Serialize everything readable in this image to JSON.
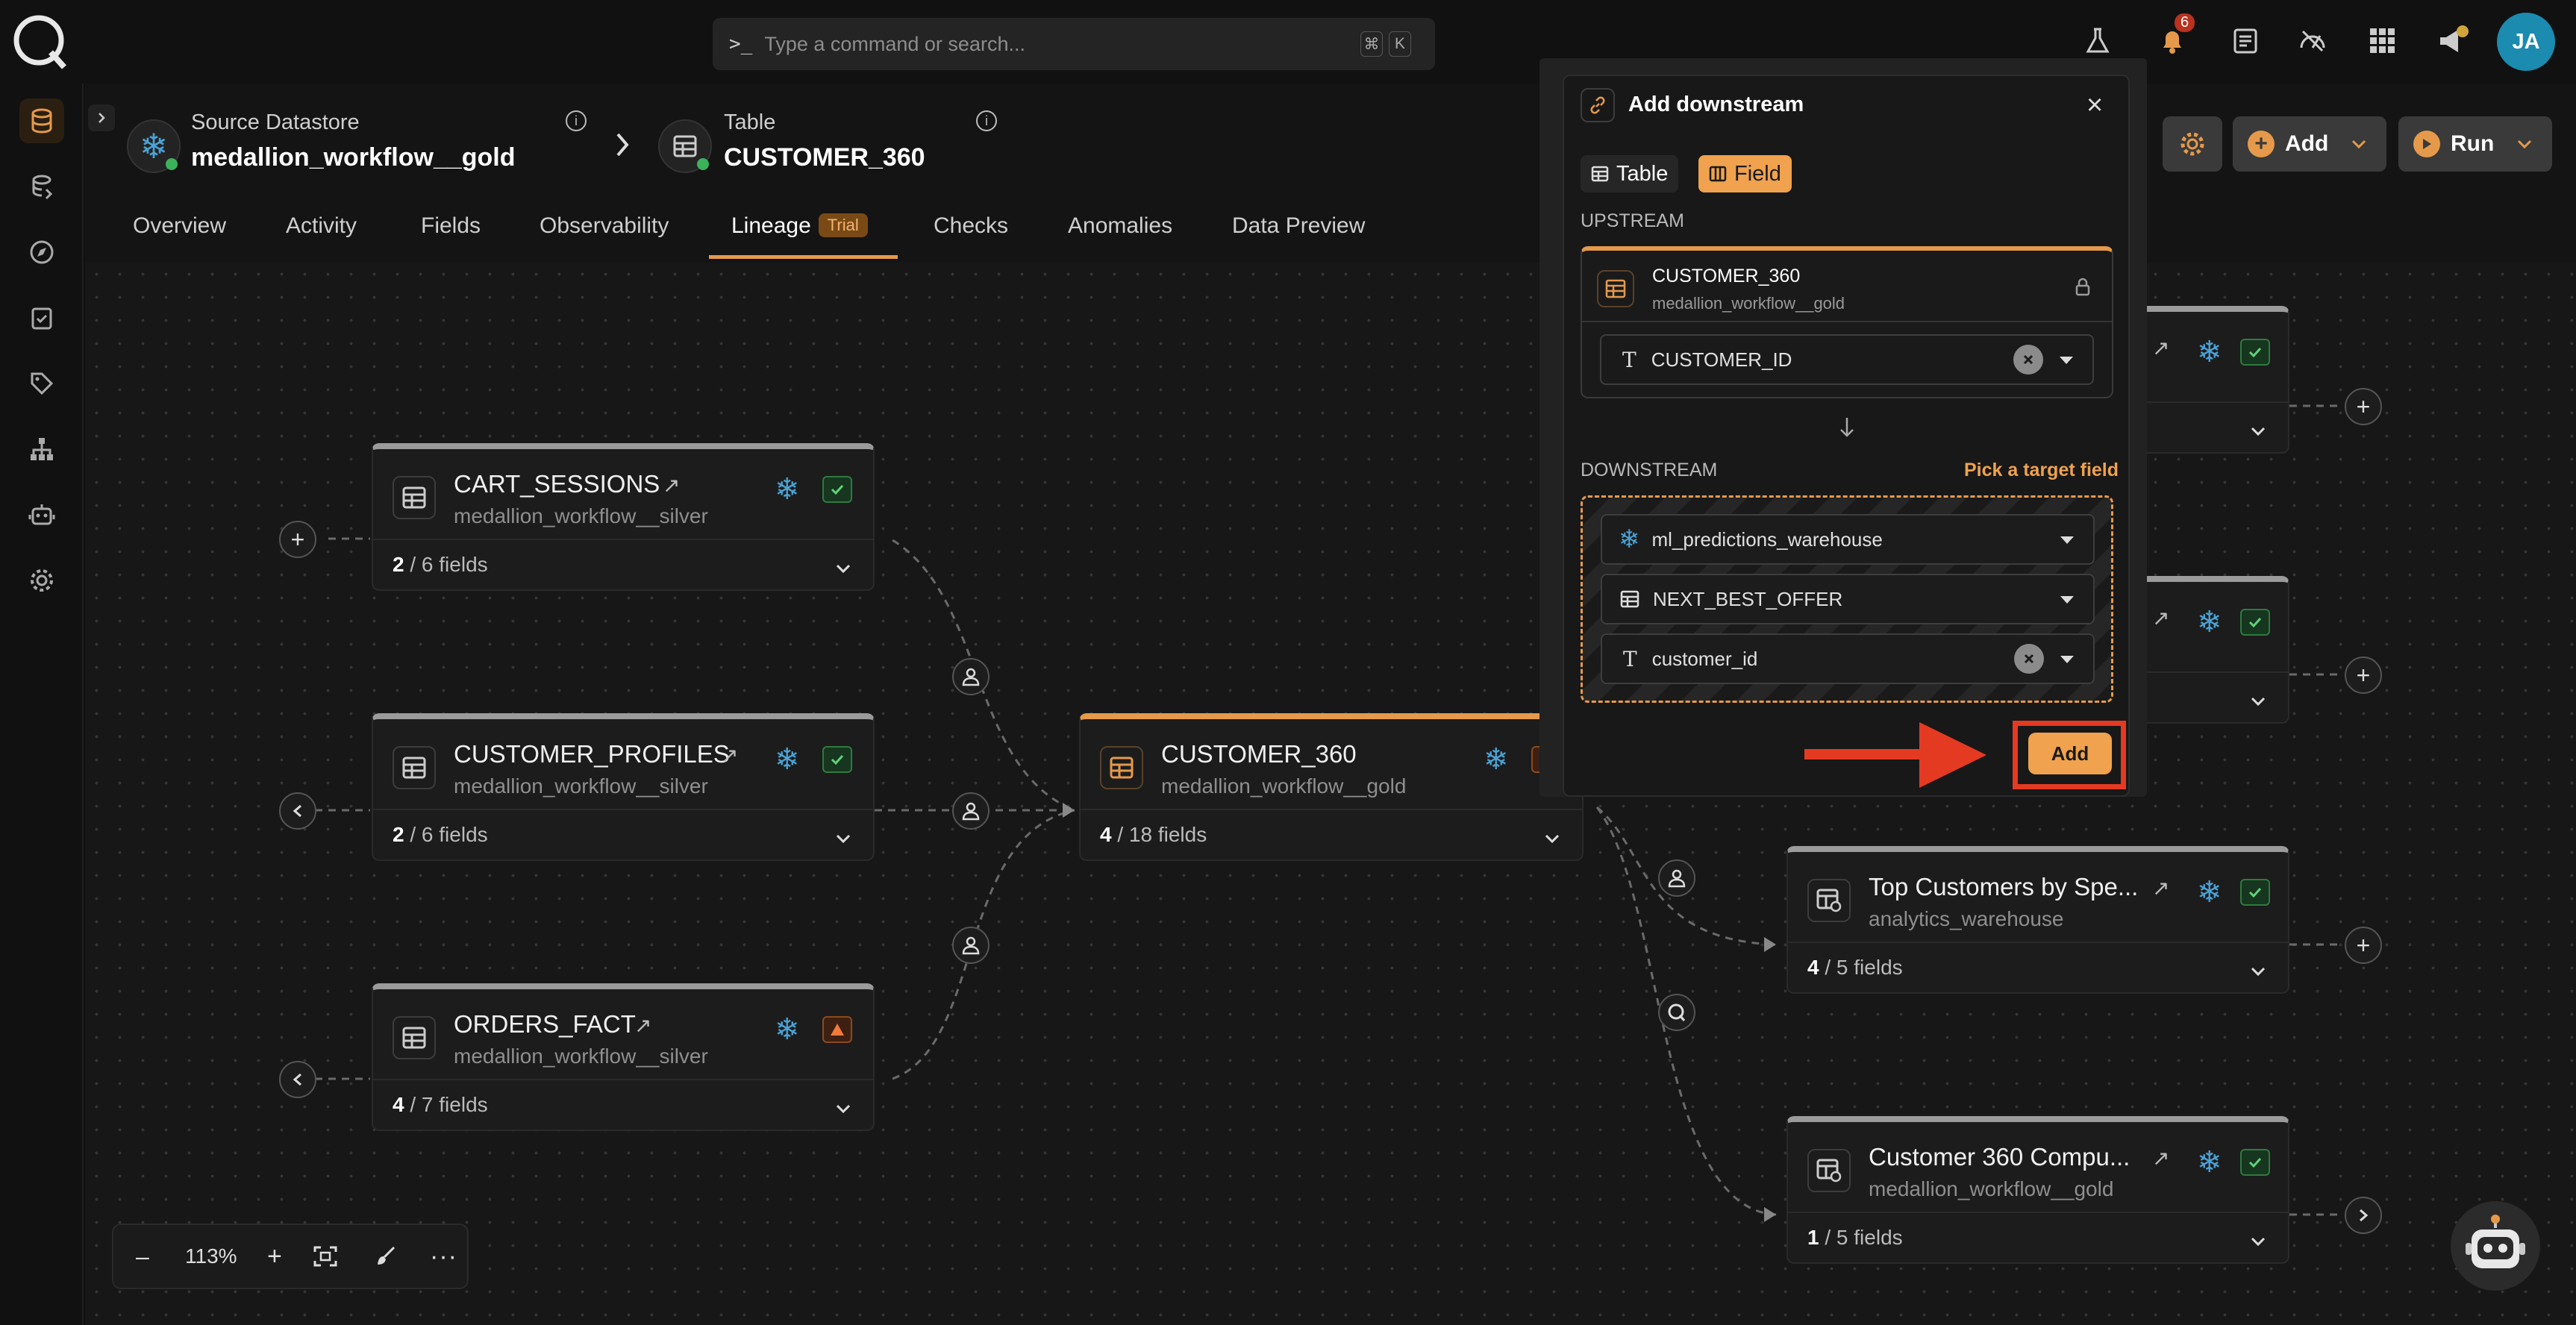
{
  "topbar": {
    "search_placeholder": "Type a command or search...",
    "shortcut_key1": "⌘",
    "shortcut_key2": "K",
    "notification_count": "6",
    "avatar_initials": "JA",
    "icons": [
      "logo-icon",
      "flask-icon",
      "bell-icon",
      "document-icon",
      "gauge-icon",
      "grid-icon",
      "megaphone-icon"
    ]
  },
  "sidebar": {
    "icons": [
      "database-icon",
      "datastore-stack-icon",
      "compass-icon",
      "checklist-icon",
      "tag-icon",
      "hierarchy-icon",
      "robot-icon",
      "gear-icon"
    ],
    "active": "database-icon"
  },
  "header": {
    "source_label": "Source Datastore",
    "source_name": "medallion_workflow__gold",
    "table_label": "Table",
    "table_name": "CUSTOMER_360",
    "settings_icon": "gear-icon",
    "add_label": "Add",
    "run_label": "Run"
  },
  "tabs": [
    {
      "label": "Overview"
    },
    {
      "label": "Activity"
    },
    {
      "label": "Fields"
    },
    {
      "label": "Observability"
    },
    {
      "label": "Lineage",
      "badge": "Trial",
      "active": true
    },
    {
      "label": "Checks"
    },
    {
      "label": "Anomalies"
    },
    {
      "label": "Data Preview"
    }
  ],
  "nodes": {
    "cart_sessions": {
      "title": "CART_SESSIONS",
      "sub": "medallion_workflow__silver",
      "fields_count": "2",
      "fields_total": "/ 6 fields",
      "status": "check"
    },
    "customer_profiles": {
      "title": "CUSTOMER_PROFILES",
      "sub": "medallion_workflow__silver",
      "fields_count": "2",
      "fields_total": "/ 6 fields",
      "status": "check"
    },
    "orders_fact": {
      "title": "ORDERS_FACT",
      "sub": "medallion_workflow__silver",
      "fields_count": "4",
      "fields_total": "/ 7 fields",
      "status": "warning"
    },
    "customer_360": {
      "title": "CUSTOMER_360",
      "sub": "medallion_workflow__gold",
      "fields_count": "4",
      "fields_total": "/ 18 fields",
      "status": "warning"
    },
    "top_customers": {
      "title": "Top Customers by Spe...",
      "sub": "analytics_warehouse",
      "fields_count": "4",
      "fields_total": "/ 5 fields",
      "status": "check"
    },
    "customer_360_compu": {
      "title": "Customer 360 Compu...",
      "sub": "medallion_workflow__gold",
      "fields_count": "1",
      "fields_total": "/ 5 fields",
      "status": "check"
    }
  },
  "zoom": {
    "level": "113%",
    "minus": "–",
    "plus": "+"
  },
  "modal": {
    "title": "Add downstream",
    "seg_table": "Table",
    "seg_field": "Field",
    "seg_selected": "Field",
    "upstream_label": "UPSTREAM",
    "upstream_table": "CUSTOMER_360",
    "upstream_datastore": "medallion_workflow__gold",
    "upstream_field": "CUSTOMER_ID",
    "downstream_label": "DOWNSTREAM",
    "pick_hint": "Pick a target field",
    "down_datastore": "ml_predictions_warehouse",
    "down_table": "NEXT_BEST_OFFER",
    "down_field": "customer_id",
    "add_label": "Add"
  },
  "colors": {
    "accent": "#e59a4b",
    "success": "#2f7a3f",
    "annotation": "#e53a22",
    "snowflake": "#4ba3d6"
  }
}
